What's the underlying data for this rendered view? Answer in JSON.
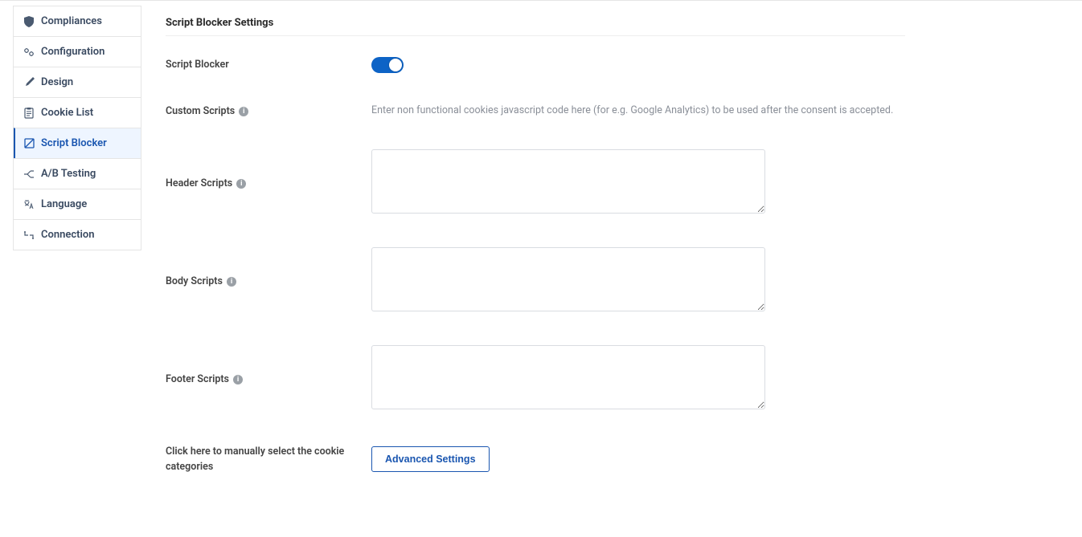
{
  "sidebar": {
    "items": [
      {
        "label": "Compliances"
      },
      {
        "label": "Configuration"
      },
      {
        "label": "Design"
      },
      {
        "label": "Cookie List"
      },
      {
        "label": "Script Blocker"
      },
      {
        "label": "A/B Testing"
      },
      {
        "label": "Language"
      },
      {
        "label": "Connection"
      }
    ]
  },
  "page": {
    "title": "Script Blocker Settings"
  },
  "form": {
    "script_blocker_label": "Script Blocker",
    "script_blocker_on": true,
    "custom_scripts_label": "Custom Scripts",
    "custom_scripts_hint": "Enter non functional cookies javascript code here (for e.g. Google Analytics) to be used after the consent is accepted.",
    "header_scripts_label": "Header Scripts",
    "header_scripts_value": "",
    "body_scripts_label": "Body Scripts",
    "body_scripts_value": "",
    "footer_scripts_label": "Footer Scripts",
    "footer_scripts_value": "",
    "manual_select_label": "Click here to manually select the cookie categories",
    "advanced_settings_label": "Advanced Settings"
  }
}
